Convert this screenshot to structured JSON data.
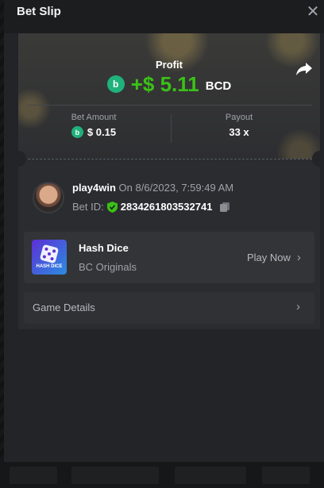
{
  "modal": {
    "title": "Bet Slip",
    "close_icon": "close-icon"
  },
  "profit": {
    "label": "Profit",
    "value": "+$ 5.11",
    "currency": "BCD",
    "coin_icon": "bcd-coin-icon",
    "share_icon": "share-icon"
  },
  "stats": {
    "bet_amount_label": "Bet Amount",
    "bet_amount_value": "$ 0.15",
    "payout_label": "Payout",
    "payout_value": "33 x"
  },
  "bet": {
    "username": "play4win",
    "time": "On 8/6/2023, 7:59:49 AM",
    "bet_id_label": "Bet ID:",
    "bet_id": "2834261803532741",
    "verified_icon": "shield-check-icon",
    "copy_icon": "copy-icon"
  },
  "game": {
    "name": "Hash Dice",
    "provider": "BC Originals",
    "thumb_text": "HASH DICE",
    "play_now": "Play Now"
  },
  "details": {
    "label": "Game Details"
  },
  "colors": {
    "profit_green": "#3bc117",
    "coin_green": "#1fb27b",
    "modal_bg": "#232427",
    "card_bg": "#2a2c30"
  }
}
